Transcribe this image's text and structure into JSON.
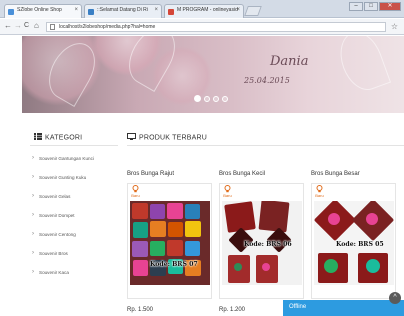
{
  "browser": {
    "tabs": [
      {
        "label": "SZlobe Online Shop",
        "active": true,
        "favicon_color": "#4a90d9"
      },
      {
        "label": "::Selamat Datang Di Ri",
        "active": false,
        "favicon_color": "#3a7fc4"
      },
      {
        "label": "M PROGRAM - onlineyasid",
        "active": false,
        "favicon_color": "#d44638"
      }
    ],
    "window_buttons": {
      "minimize": "–",
      "maximize": "□",
      "close": "✕"
    },
    "nav": {
      "back": "←",
      "forward": "→",
      "reload": "C",
      "home": "⌂"
    },
    "url": "localhost/s2lobeshop/media.php?hal=home"
  },
  "banner": {
    "script_name": "Dania",
    "date": "25.04.2015",
    "slide_count": 4,
    "active_slide": 0
  },
  "categories": {
    "heading": "KATEGORI",
    "items": [
      "Souvenir Gantungan Kunci",
      "Souvenir Gunting Kuku",
      "Souvenir Gelas",
      "Souvenir Dompet",
      "Souvenir Centong",
      "Souvenir Bros",
      "Souvenir Kaca"
    ]
  },
  "products": {
    "heading": "PRODUK TERBARU",
    "badge_label": "Baru",
    "items": [
      {
        "name": "Bros Bunga Rajut",
        "code": "Kode: BRS 07",
        "price": "Rp. 1.500"
      },
      {
        "name": "Bros Bunga Kecil",
        "code": "Kode: BRS 06",
        "price": "Rp. 1.200"
      },
      {
        "name": "Bros Bunga Besar",
        "code": "Kode: BRS 05",
        "price": ""
      }
    ]
  },
  "chat": {
    "label": "Offline"
  },
  "colors": {
    "accent": "#2d9be0",
    "badge": "#e06b1a"
  }
}
